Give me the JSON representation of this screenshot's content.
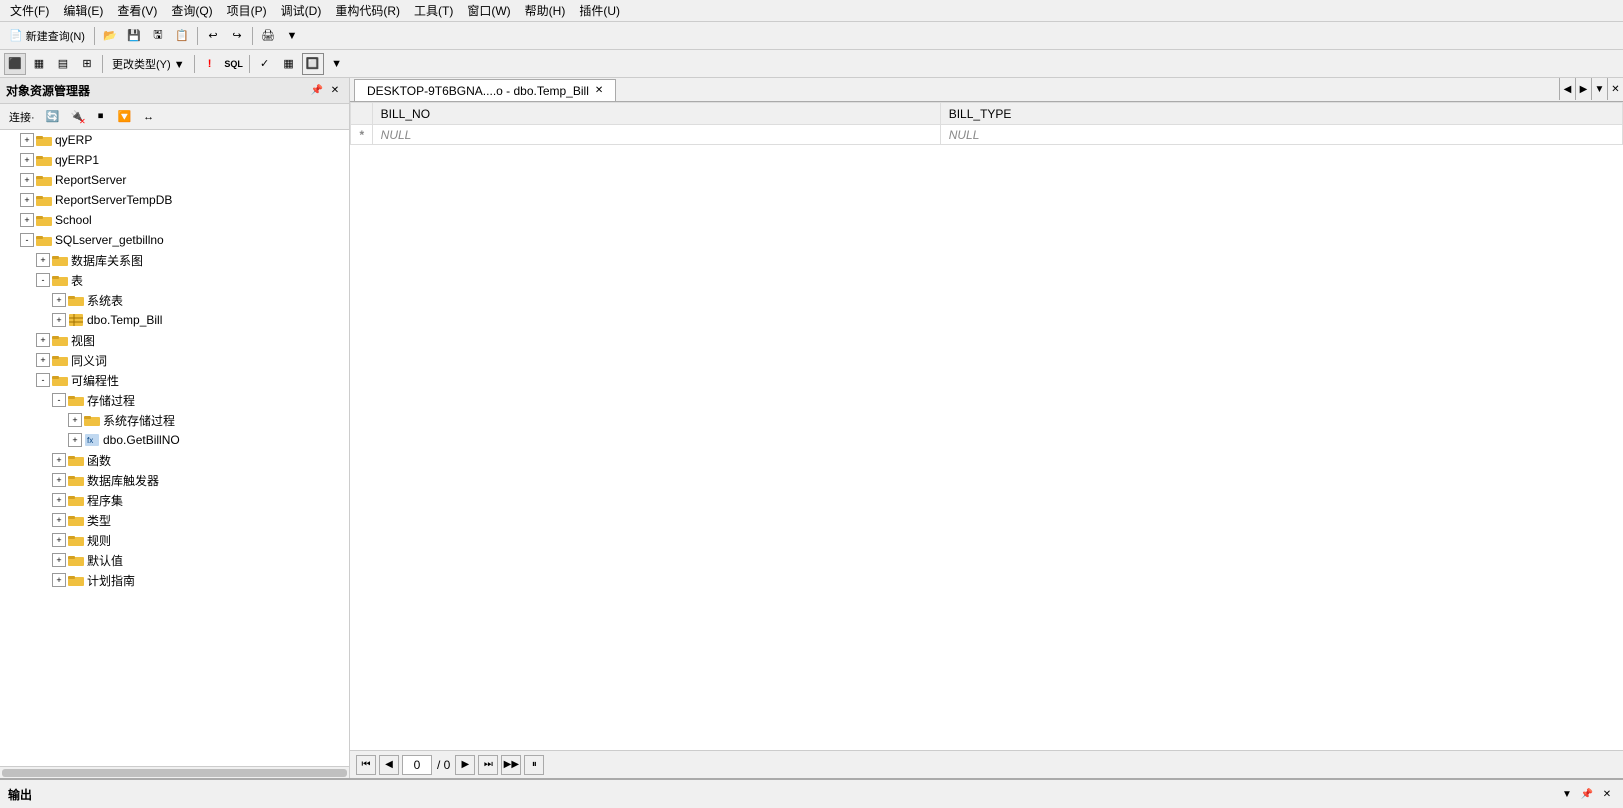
{
  "menubar": {
    "items": [
      "文件(F)",
      "编辑(E)",
      "查看(V)",
      "查询(Q)",
      "项目(P)",
      "调试(D)",
      "重构代码(R)",
      "工具(T)",
      "窗口(W)",
      "帮助(H)",
      "插件(U)"
    ]
  },
  "toolbar1": {
    "new_query": "新建查询(N)"
  },
  "sidebar": {
    "title": "对象资源管理器",
    "connect_btn": "连接·",
    "tree": [
      {
        "id": "qyERP",
        "label": "qyERP",
        "indent": 1,
        "expand": "+",
        "type": "db"
      },
      {
        "id": "qyERP1",
        "label": "qyERP1",
        "indent": 1,
        "expand": "+",
        "type": "db"
      },
      {
        "id": "ReportServer",
        "label": "ReportServer",
        "indent": 1,
        "expand": "+",
        "type": "db"
      },
      {
        "id": "ReportServerTempDB",
        "label": "ReportServerTempDB",
        "indent": 1,
        "expand": "+",
        "type": "db"
      },
      {
        "id": "School",
        "label": "School",
        "indent": 1,
        "expand": "+",
        "type": "db"
      },
      {
        "id": "SQLserver_getbillno",
        "label": "SQLserver_getbillno",
        "indent": 1,
        "expand": "-",
        "type": "db"
      },
      {
        "id": "db_diagram",
        "label": "数据库关系图",
        "indent": 2,
        "expand": "+",
        "type": "folder"
      },
      {
        "id": "tables",
        "label": "表",
        "indent": 2,
        "expand": "-",
        "type": "folder"
      },
      {
        "id": "sys_tables",
        "label": "系统表",
        "indent": 3,
        "expand": "+",
        "type": "folder"
      },
      {
        "id": "dbo_temp_bill",
        "label": "dbo.Temp_Bill",
        "indent": 3,
        "expand": "+",
        "type": "table"
      },
      {
        "id": "views",
        "label": "视图",
        "indent": 2,
        "expand": "+",
        "type": "folder"
      },
      {
        "id": "synonyms",
        "label": "同义词",
        "indent": 2,
        "expand": "+",
        "type": "folder"
      },
      {
        "id": "programmability",
        "label": "可编程性",
        "indent": 2,
        "expand": "-",
        "type": "folder"
      },
      {
        "id": "stored_procs",
        "label": "存储过程",
        "indent": 3,
        "expand": "-",
        "type": "folder"
      },
      {
        "id": "sys_stored_procs",
        "label": "系统存储过程",
        "indent": 4,
        "expand": "+",
        "type": "folder"
      },
      {
        "id": "dbo_getbillno",
        "label": "dbo.GetBillNO",
        "indent": 4,
        "expand": "+",
        "type": "proc"
      },
      {
        "id": "functions",
        "label": "函数",
        "indent": 3,
        "expand": "+",
        "type": "folder"
      },
      {
        "id": "db_triggers",
        "label": "数据库触发器",
        "indent": 3,
        "expand": "+",
        "type": "folder"
      },
      {
        "id": "assemblies",
        "label": "程序集",
        "indent": 3,
        "expand": "+",
        "type": "folder"
      },
      {
        "id": "types",
        "label": "类型",
        "indent": 3,
        "expand": "+",
        "type": "folder"
      },
      {
        "id": "rules",
        "label": "规则",
        "indent": 3,
        "expand": "+",
        "type": "folder"
      },
      {
        "id": "defaults",
        "label": "默认值",
        "indent": 3,
        "expand": "+",
        "type": "folder"
      },
      {
        "id": "plan_guides",
        "label": "计划指南",
        "indent": 3,
        "expand": "+",
        "type": "folder"
      }
    ]
  },
  "tab": {
    "label": "DESKTOP-9T6BGNA....o - dbo.Temp_Bill"
  },
  "grid": {
    "columns": [
      "BILL_NO",
      "BILL_TYPE"
    ],
    "rows": [
      {
        "indicator": "*",
        "values": [
          "NULL",
          "NULL"
        ]
      }
    ]
  },
  "pagination": {
    "current_page": "0",
    "total": "/ 0"
  },
  "output": {
    "label": "输出"
  }
}
